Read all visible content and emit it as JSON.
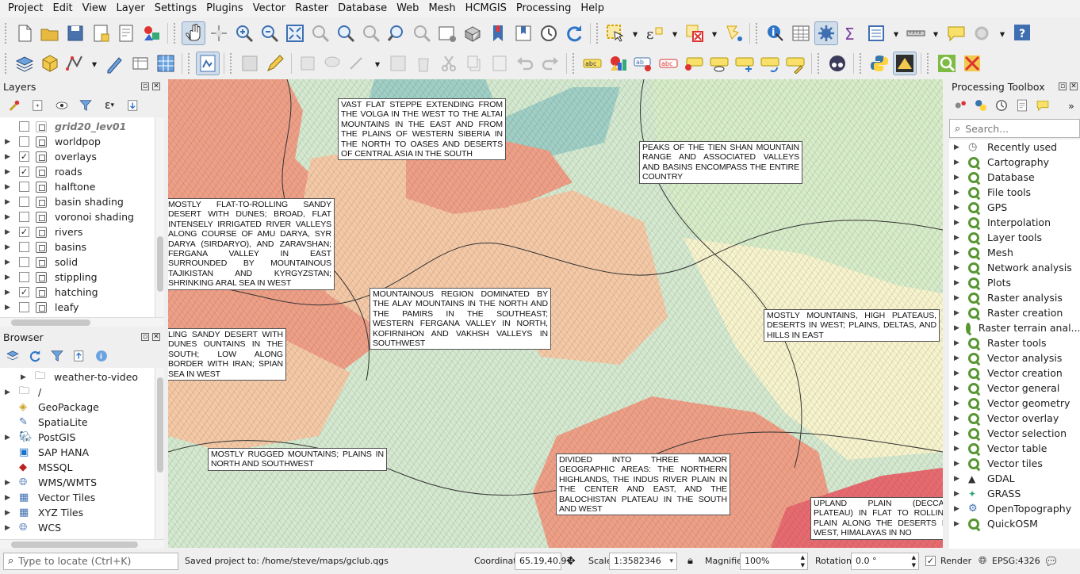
{
  "menu": [
    "Project",
    "Edit",
    "View",
    "Layer",
    "Settings",
    "Plugins",
    "Vector",
    "Raster",
    "Database",
    "Web",
    "Mesh",
    "HCMGIS",
    "Processing",
    "Help"
  ],
  "layers_panel": {
    "title": "Layers",
    "items": [
      {
        "name": "grid20_lev01",
        "checked": false,
        "expand": false,
        "italic": true
      },
      {
        "name": "worldpop",
        "checked": false,
        "expand": true
      },
      {
        "name": "overlays",
        "checked": true,
        "expand": true
      },
      {
        "name": "roads",
        "checked": true,
        "expand": true
      },
      {
        "name": "halftone",
        "checked": false,
        "expand": true
      },
      {
        "name": "basin shading",
        "checked": false,
        "expand": true
      },
      {
        "name": "voronoi shading",
        "checked": false,
        "expand": true
      },
      {
        "name": "rivers",
        "checked": true,
        "expand": true
      },
      {
        "name": "basins",
        "checked": false,
        "expand": true
      },
      {
        "name": "solid",
        "checked": false,
        "expand": true
      },
      {
        "name": "stippling",
        "checked": false,
        "expand": true
      },
      {
        "name": "hatching",
        "checked": true,
        "expand": true
      },
      {
        "name": "leafy",
        "checked": false,
        "expand": true
      }
    ]
  },
  "browser_panel": {
    "title": "Browser",
    "items": [
      {
        "name": "weather-to-video",
        "icon": "folder-icon",
        "indent": 2
      },
      {
        "name": "/",
        "icon": "folder-icon",
        "indent": 1
      },
      {
        "name": "GeoPackage",
        "icon": "geopackage-icon",
        "indent": 1
      },
      {
        "name": "SpatiaLite",
        "icon": "spatialite-icon",
        "indent": 1
      },
      {
        "name": "PostGIS",
        "icon": "postgis-icon",
        "indent": 1
      },
      {
        "name": "SAP HANA",
        "icon": "saphana-icon",
        "indent": 1
      },
      {
        "name": "MSSQL",
        "icon": "mssql-icon",
        "indent": 1
      },
      {
        "name": "WMS/WMTS",
        "icon": "globe-icon",
        "indent": 1
      },
      {
        "name": "Vector Tiles",
        "icon": "grid-icon",
        "indent": 1
      },
      {
        "name": "XYZ Tiles",
        "icon": "grid-icon",
        "indent": 1
      },
      {
        "name": "WCS",
        "icon": "globe-icon",
        "indent": 1
      }
    ]
  },
  "toolbox": {
    "title": "Processing Toolbox",
    "search_placeholder": "Search...",
    "items": [
      "Recently used",
      "Cartography",
      "Database",
      "File tools",
      "GPS",
      "Interpolation",
      "Layer tools",
      "Mesh",
      "Network analysis",
      "Plots",
      "Raster analysis",
      "Raster creation",
      "Raster terrain anal...",
      "Raster tools",
      "Vector analysis",
      "Vector creation",
      "Vector general",
      "Vector geometry",
      "Vector overlay",
      "Vector selection",
      "Vector table",
      "Vector tiles",
      "GDAL",
      "GRASS",
      "OpenTopography",
      "QuickOSM"
    ]
  },
  "map_labels": [
    "Vast flat steppe extending from the Volga in the west to the Altai Mountains in the east and from the plains of western Siberia in the north to oases and deserts of Central Asia in the south",
    "Peaks of the Tien Shan mountain range and associated valleys and basins encompass the entire country",
    "Mostly flat-to-rolling sandy desert with dunes; broad, flat intensely irrigated river valleys along course of Amu Darya, Syr Darya (Sirdaryo), and Zaravshan; Fergana Valley in east surrounded by mountainous Tajikistan and Kyrgyzstan; shrinking Aral Sea in west",
    "Mountainous region dominated by the Alay Mountains in the north and the Pamirs in the southeast; western Fergana Valley in north, Kofirnihon and Vakhsh Valleys in southwest",
    "Mostly mountains, high plateaus, deserts in west; plains, deltas, and hills in east",
    "ling sandy desert with dunes ountains in the south; low along border with Iran; spian Sea in west",
    "Mostly rugged mountains; plains in north and southwest",
    "Divided into three major geographic areas: the northern highlands, the Indus River plain in the center and east, and the Balochistan Plateau in the south and west",
    "Upland plain (Deccan Plateau) in flat to rolling plain along the deserts in west, Himalayas in no"
  ],
  "status": {
    "locate_placeholder": "Type to locate (Ctrl+K)",
    "message": "Saved project to: /home/steve/maps/gclub.qgs",
    "coordinate_label": "Coordinate",
    "coordinate": "65.19,40.97",
    "scale_label": "Scale",
    "scale": "1:3582346",
    "magnifier_label": "Magnifier",
    "magnifier": "100%",
    "rotation_label": "Rotation",
    "rotation": "0.0 °",
    "render_label": "Render",
    "crs": "EPSG:4326"
  }
}
